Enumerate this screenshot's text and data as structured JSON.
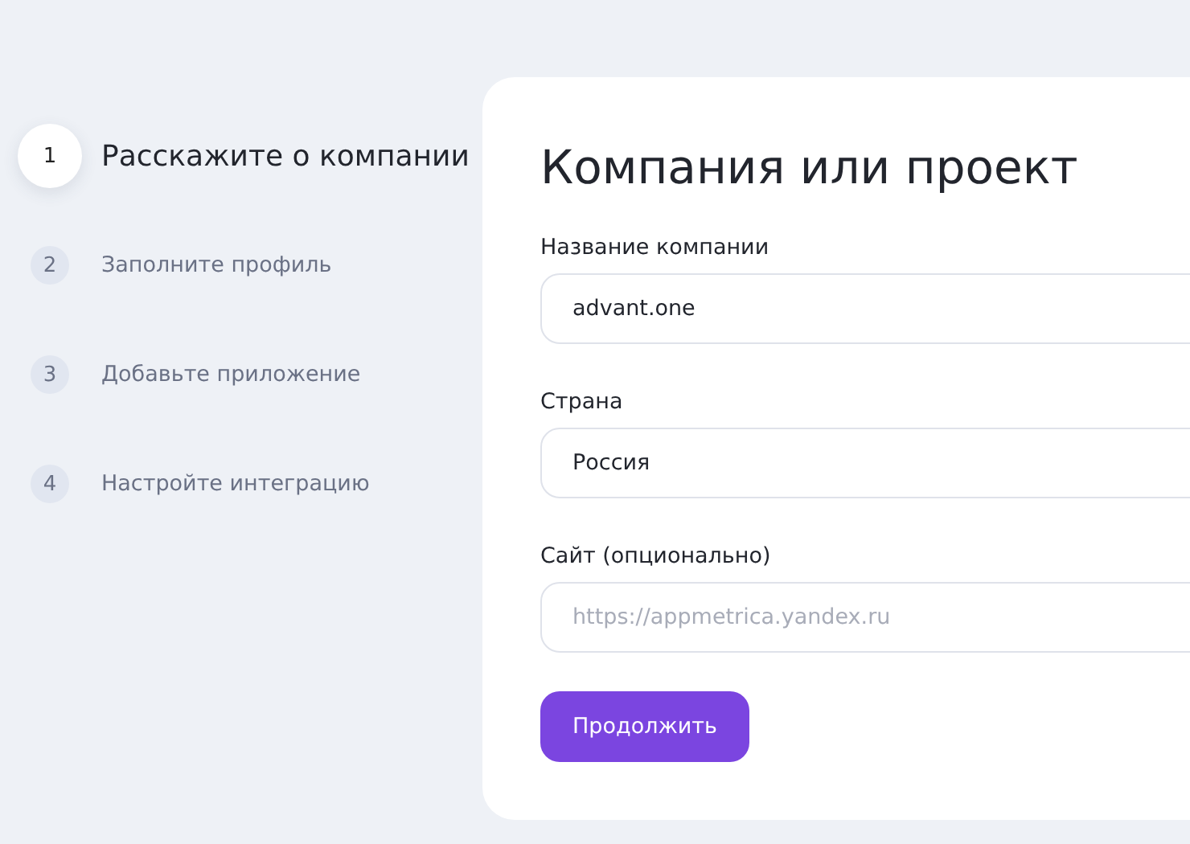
{
  "steps": [
    {
      "number": "1",
      "label": "Расскажите о компании",
      "selected": true
    },
    {
      "number": "2",
      "label": "Заполните профиль",
      "selected": false
    },
    {
      "number": "3",
      "label": "Добавьте приложение",
      "selected": false
    },
    {
      "number": "4",
      "label": "Настройте интеграцию",
      "selected": false
    }
  ],
  "form": {
    "title": "Компания или проект",
    "fields": [
      {
        "label": "Название компании",
        "value": "advant.one"
      },
      {
        "label": "Страна",
        "value": "Россия"
      },
      {
        "label": "Сайт (опционально)",
        "placeholder": "https://appmetrica.yandex.ru"
      }
    ],
    "submit": "Продолжить"
  }
}
